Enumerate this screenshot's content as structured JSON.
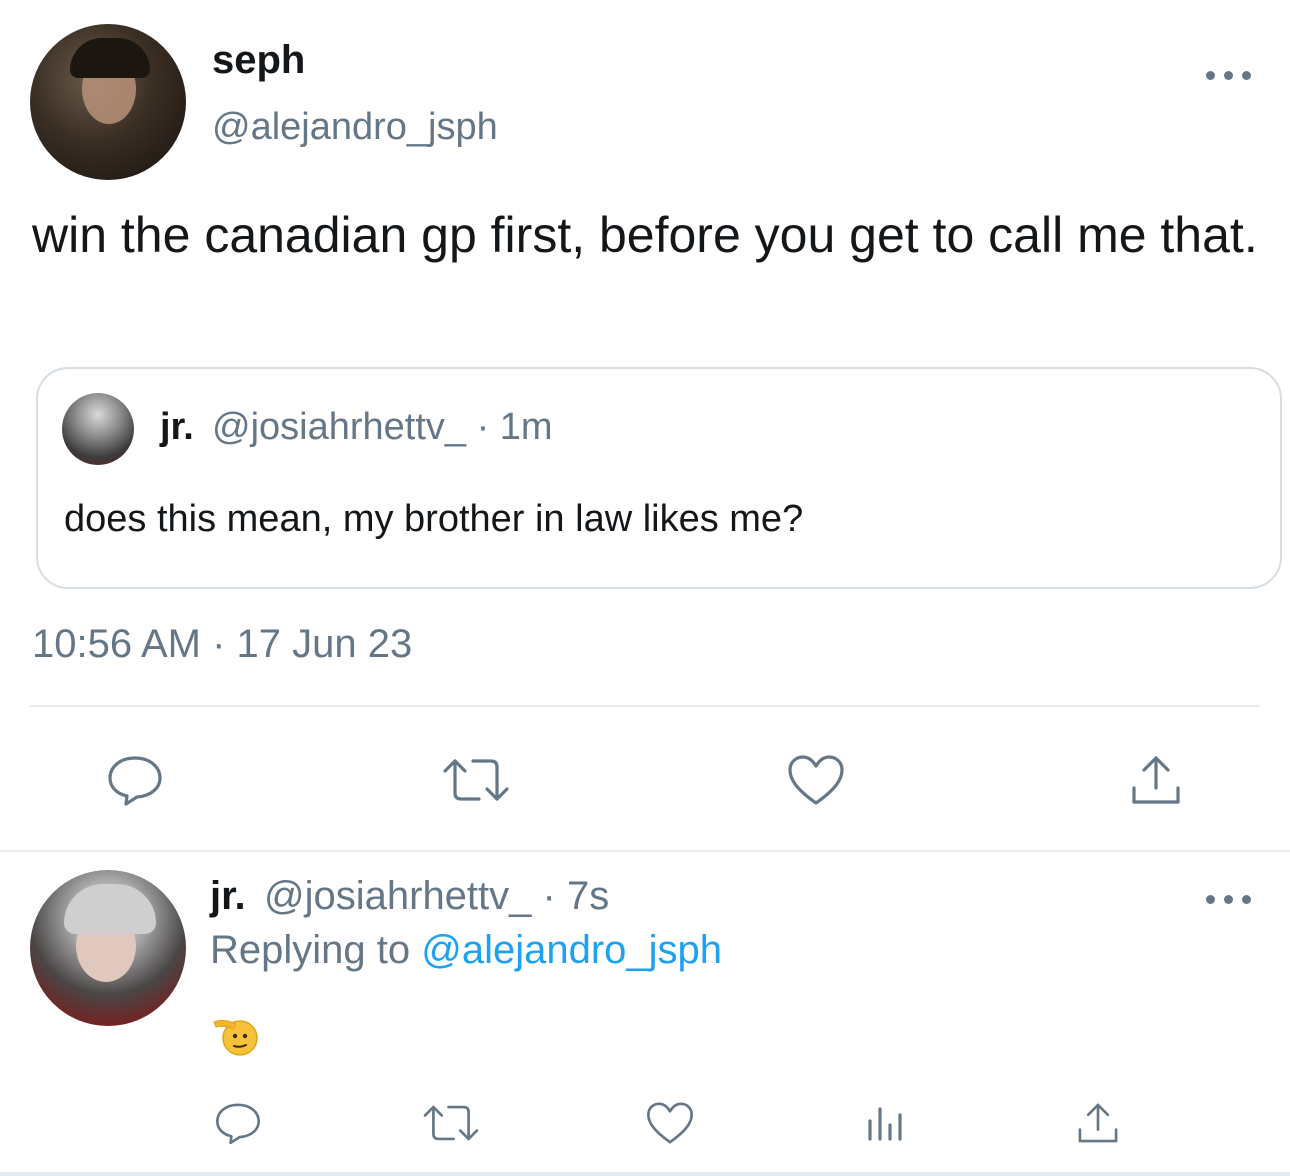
{
  "main_tweet": {
    "author_name": "seph",
    "author_handle": "@alejandro_jsph",
    "text": "win the canadian gp first, before you get to call me that.",
    "timestamp": "10:56 AM · 17 Jun 23",
    "quoted_tweet": {
      "author_name": "jr.",
      "author_handle_time": "@josiahrhettv_ · 1m",
      "text": "does this mean, my brother in law likes me?"
    },
    "actions": [
      "reply-icon",
      "retweet-icon",
      "like-icon",
      "share-icon"
    ]
  },
  "reply_tweet": {
    "author_name": "jr.",
    "author_handle_time": "@josiahrhettv_ · 7s",
    "replying_prefix": "Replying to",
    "replying_handle": "@alejandro_jsph",
    "emoji_name": "saluting-face",
    "actions": [
      "reply-icon",
      "retweet-icon",
      "like-icon",
      "analytics-icon",
      "share-icon"
    ]
  },
  "colors": {
    "text": "#14171a",
    "secondary": "#657786",
    "link": "#1da1f2",
    "border": "#d6dde3"
  }
}
